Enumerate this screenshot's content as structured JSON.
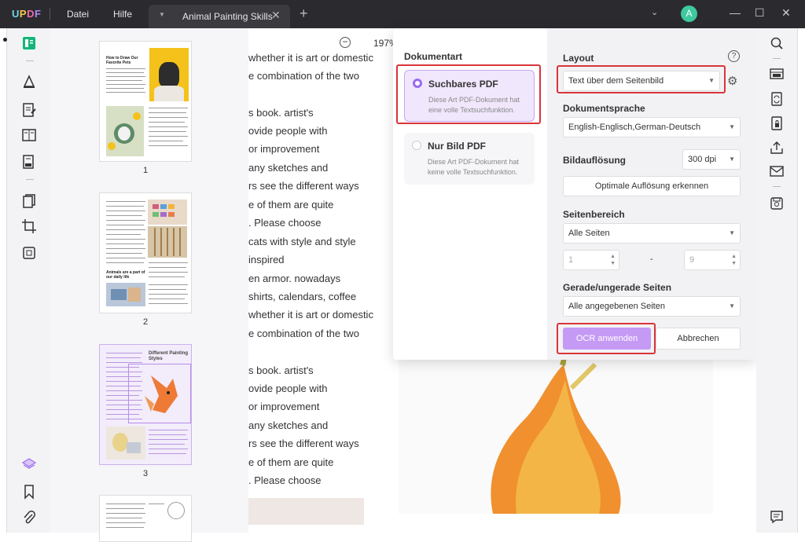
{
  "app": {
    "logo": [
      "U",
      "P",
      "D",
      "F"
    ],
    "menu": [
      "Datei",
      "Hilfe"
    ],
    "tab_title": "Animal Painting Skills",
    "avatar_letter": "A"
  },
  "thumbnails": [
    {
      "num": "1",
      "heading": "How to Draw Our Favorite Pets"
    },
    {
      "num": "2",
      "heading": "Animals are a part of our daily life"
    },
    {
      "num": "3",
      "heading": "Different Painting Styles"
    }
  ],
  "zoom": {
    "value": "197%"
  },
  "document": {
    "lines": [
      "whether it is art or domestic",
      "e combination of the two",
      "s book. artist's",
      "ovide people with",
      "or improvement",
      "any sketches and",
      "rs see the different ways",
      "e of them are quite",
      ". Please choose",
      "cats with style and style",
      "inspired",
      "en armor. nowadays",
      "shirts, calendars, coffee",
      "whether it is art or domestic",
      "e combination of the two",
      "s book. artist's",
      "ovide people with",
      "or improvement",
      "any sketches and",
      "rs see the different ways",
      "e of them are quite",
      ". Please choose"
    ]
  },
  "ocr": {
    "doc_type_title": "Dokumentart",
    "options": [
      {
        "title": "Suchbares PDF",
        "desc": "Diese Art PDF-Dokument hat eine volle Textsuchfunktion.",
        "selected": true
      },
      {
        "title": "Nur Bild PDF",
        "desc": "Diese Art PDF-Dokument hat keine volle Textsuchfunktion.",
        "selected": false
      }
    ],
    "layout_title": "Layout",
    "layout_value": "Text über dem Seitenbild",
    "language_title": "Dokumentsprache",
    "language_value": "English-Englisch,German-Deutsch",
    "resolution_title": "Bildauflösung",
    "resolution_value": "300 dpi",
    "detect_button": "Optimale Auflösung erkennen",
    "range_title": "Seitenbereich",
    "range_value": "Alle Seiten",
    "range_from": "1",
    "range_dash": "-",
    "range_to": "9",
    "parity_title": "Gerade/ungerade Seiten",
    "parity_value": "Alle angegebenen Seiten",
    "apply_button": "OCR anwenden",
    "cancel_button": "Abbrechen"
  },
  "colors": {
    "accent": "#9b6cf0",
    "apply_button": "#c59af5",
    "highlight": "#d9353a",
    "titlebar": "#2b2b2f"
  }
}
